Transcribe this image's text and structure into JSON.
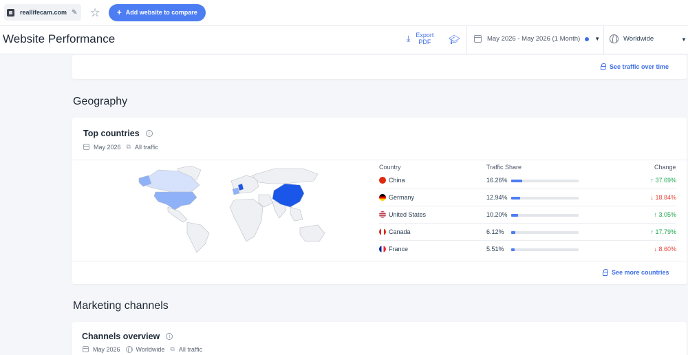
{
  "topbar": {
    "site": "reallifecam.com",
    "add_label": "Add website to compare"
  },
  "header": {
    "title": "Website Performance",
    "export_line1": "Export",
    "export_line2": "PDF",
    "date_range": "May 2026 - May 2026 (1 Month)",
    "region": "Worldwide"
  },
  "traffic_card": {
    "link": "See traffic over time"
  },
  "geography": {
    "section_title": "Geography",
    "card_title": "Top countries",
    "meta_date": "May 2026",
    "meta_traffic": "All traffic",
    "headers": {
      "country": "Country",
      "share": "Traffic Share",
      "change": "Change"
    },
    "rows": [
      {
        "country": "China",
        "share": "16.26%",
        "share_value": 16.26,
        "change": "37.69%",
        "direction": "up"
      },
      {
        "country": "Germany",
        "share": "12.94%",
        "share_value": 12.94,
        "change": "18.84%",
        "direction": "down"
      },
      {
        "country": "United States",
        "share": "10.20%",
        "share_value": 10.2,
        "change": "3.05%",
        "direction": "up"
      },
      {
        "country": "Canada",
        "share": "6.12%",
        "share_value": 6.12,
        "change": "17.79%",
        "direction": "up"
      },
      {
        "country": "France",
        "share": "5.51%",
        "share_value": 5.51,
        "change": "8.60%",
        "direction": "down"
      }
    ],
    "link": "See more countries"
  },
  "marketing": {
    "section_title": "Marketing channels",
    "card_title": "Channels overview",
    "meta_date": "May 2026",
    "meta_region": "Worldwide",
    "meta_traffic": "All traffic"
  },
  "colors": {
    "accent": "#4d7df2",
    "link": "#3d6ee6",
    "up": "#1fa84f",
    "down": "#e5473b",
    "map_strong": "#1a56e8",
    "map_medium": "#8fb1f7",
    "map_light": "#d6e2fb"
  }
}
